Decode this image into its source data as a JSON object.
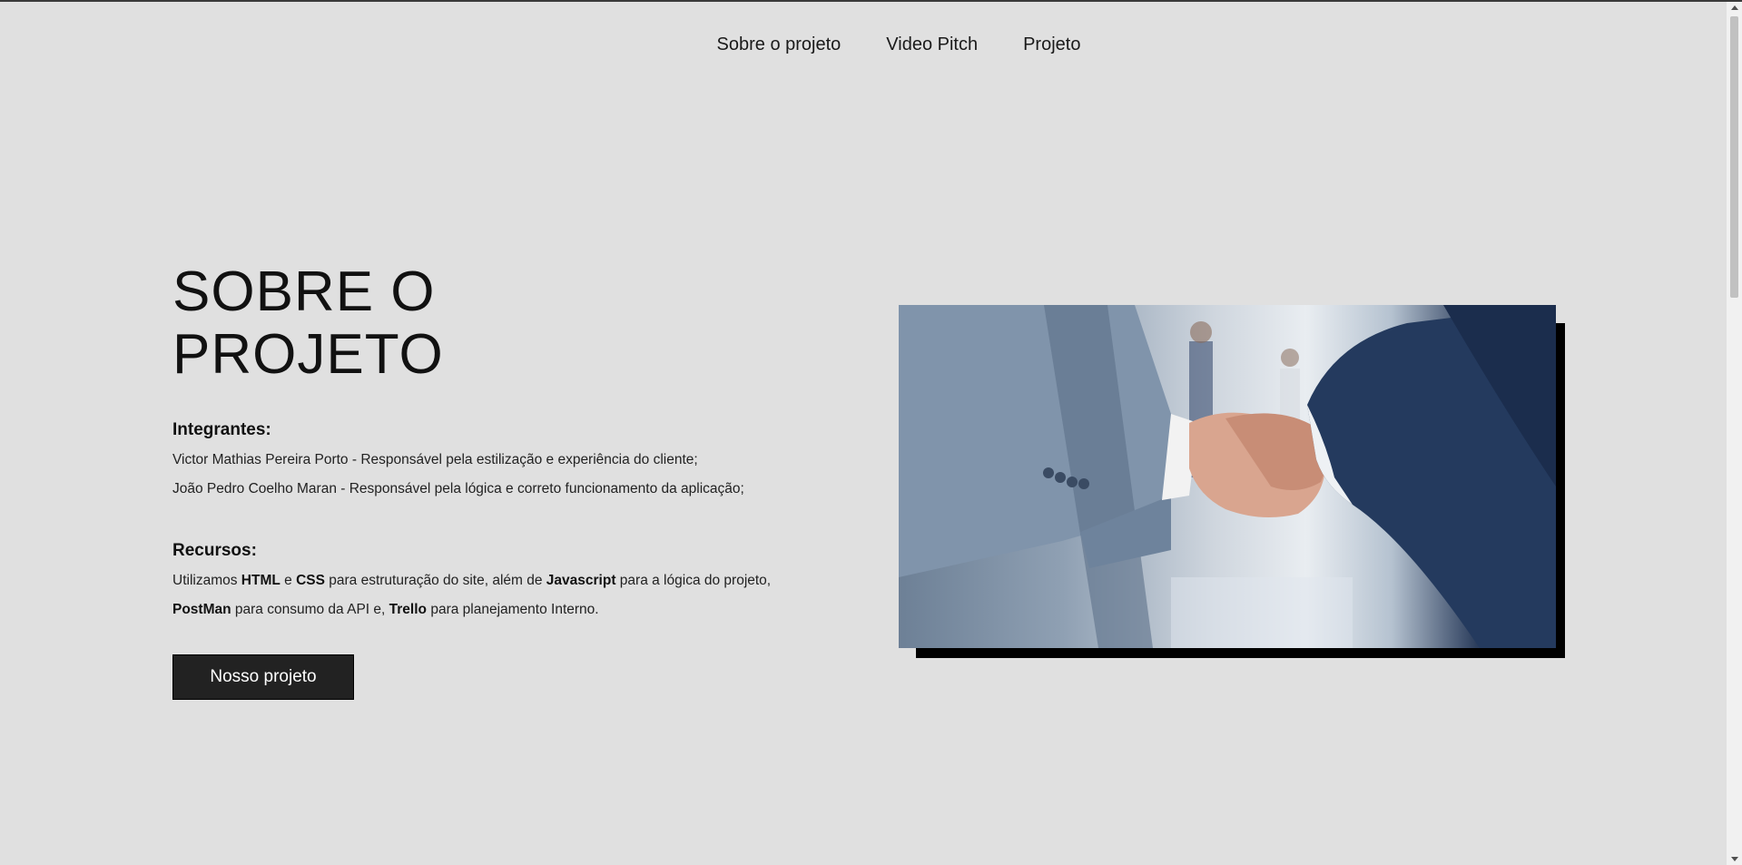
{
  "nav": {
    "items": [
      "Sobre o projeto",
      "Video Pitch",
      "Projeto"
    ]
  },
  "hero": {
    "title_line1": "SOBRE O",
    "title_line2": "PROJETO"
  },
  "integrantes": {
    "heading": "Integrantes:",
    "members": [
      "Victor Mathias Pereira Porto - Responsável pela estilização e experiência do cliente;",
      "João Pedro Coelho Maran - Responsável pela lógica e correto funcionamento da aplicação;"
    ]
  },
  "recursos": {
    "heading": "Recursos:",
    "line1": {
      "t1": "Utilizamos ",
      "b1": "HTML",
      "t2": " e ",
      "b2": "CSS",
      "t3": " para estruturação do site, além de ",
      "b3": "Javascript",
      "t4": " para a lógica do projeto,"
    },
    "line2": {
      "b1": "PostMan",
      "t1": " para consumo da API e, ",
      "b2": "Trello",
      "t2": " para planejamento Interno."
    }
  },
  "cta": {
    "label": "Nosso projeto"
  },
  "image": {
    "subject": "handshake-photo"
  }
}
